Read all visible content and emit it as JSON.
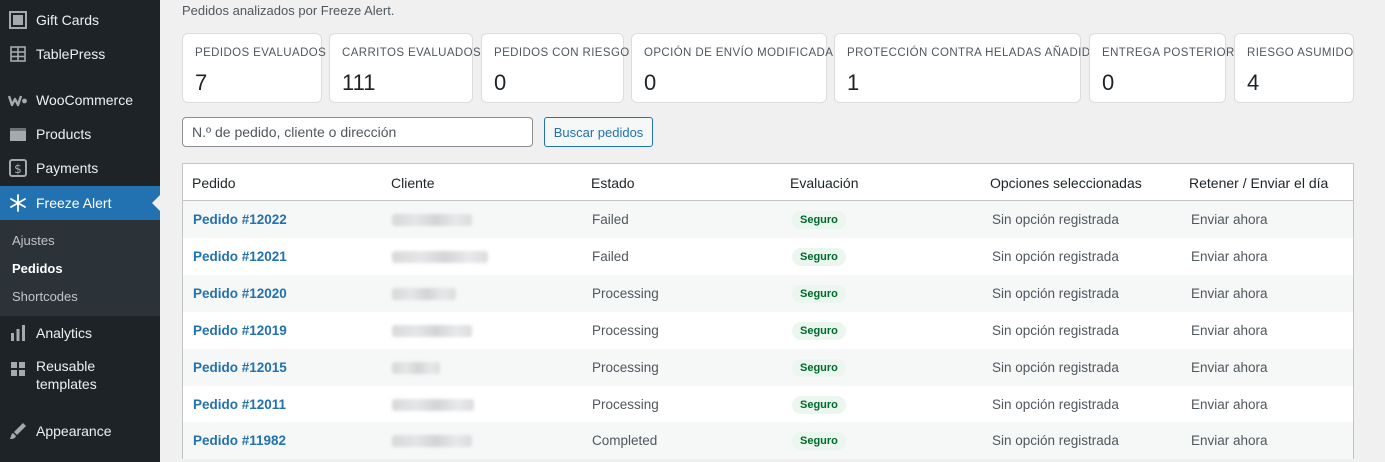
{
  "sidebar": {
    "items": [
      {
        "label": "Gift Cards",
        "icon": "gift-cards-icon"
      },
      {
        "label": "TablePress",
        "icon": "table-icon"
      },
      {
        "label": "WooCommerce",
        "icon": "woocommerce-icon"
      },
      {
        "label": "Products",
        "icon": "products-icon"
      },
      {
        "label": "Payments",
        "icon": "payments-icon"
      },
      {
        "label": "Freeze Alert",
        "icon": "snowflake-icon"
      },
      {
        "label": "Analytics",
        "icon": "analytics-icon"
      },
      {
        "label": "Reusable templates",
        "icon": "grid-icon"
      },
      {
        "label": "Appearance",
        "icon": "brush-icon"
      }
    ],
    "submenu": [
      {
        "label": "Ajustes"
      },
      {
        "label": "Pedidos"
      },
      {
        "label": "Shortcodes"
      }
    ]
  },
  "colors": {
    "accent": "#2271b1",
    "sidebar_bg": "#1d2327",
    "badge_bg": "#eaf6ee",
    "badge_text": "#00692b"
  },
  "main": {
    "subtitle": "Pedidos analizados por Freeze Alert.",
    "stats": [
      {
        "label": "Pedidos evaluados",
        "value": "7"
      },
      {
        "label": "Carritos evaluados",
        "value": "111"
      },
      {
        "label": "Pedidos con riesgo",
        "value": "0"
      },
      {
        "label": "Opción de envío modificada",
        "value": "0"
      },
      {
        "label": "Protección contra heladas añadida",
        "value": "1"
      },
      {
        "label": "Entrega posterior",
        "value": "0"
      },
      {
        "label": "Riesgo asumido",
        "value": "4"
      }
    ],
    "search": {
      "placeholder": "N.º de pedido, cliente o dirección",
      "value": "",
      "button_label": "Buscar pedidos"
    },
    "table": {
      "headers": [
        "Pedido",
        "Cliente",
        "Estado",
        "Evaluación",
        "Opciones seleccionadas",
        "Retener / Enviar el día"
      ],
      "rows": [
        {
          "order": "Pedido #12022",
          "status": "Failed",
          "evaluation": "Seguro",
          "options": "Sin opción registrada",
          "action": "Enviar ahora"
        },
        {
          "order": "Pedido #12021",
          "status": "Failed",
          "evaluation": "Seguro",
          "options": "Sin opción registrada",
          "action": "Enviar ahora"
        },
        {
          "order": "Pedido #12020",
          "status": "Processing",
          "evaluation": "Seguro",
          "options": "Sin opción registrada",
          "action": "Enviar ahora"
        },
        {
          "order": "Pedido #12019",
          "status": "Processing",
          "evaluation": "Seguro",
          "options": "Sin opción registrada",
          "action": "Enviar ahora"
        },
        {
          "order": "Pedido #12015",
          "status": "Processing",
          "evaluation": "Seguro",
          "options": "Sin opción registrada",
          "action": "Enviar ahora"
        },
        {
          "order": "Pedido #12011",
          "status": "Processing",
          "evaluation": "Seguro",
          "options": "Sin opción registrada",
          "action": "Enviar ahora"
        },
        {
          "order": "Pedido #11982",
          "status": "Completed",
          "evaluation": "Seguro",
          "options": "Sin opción registrada",
          "action": "Enviar ahora"
        }
      ]
    }
  }
}
